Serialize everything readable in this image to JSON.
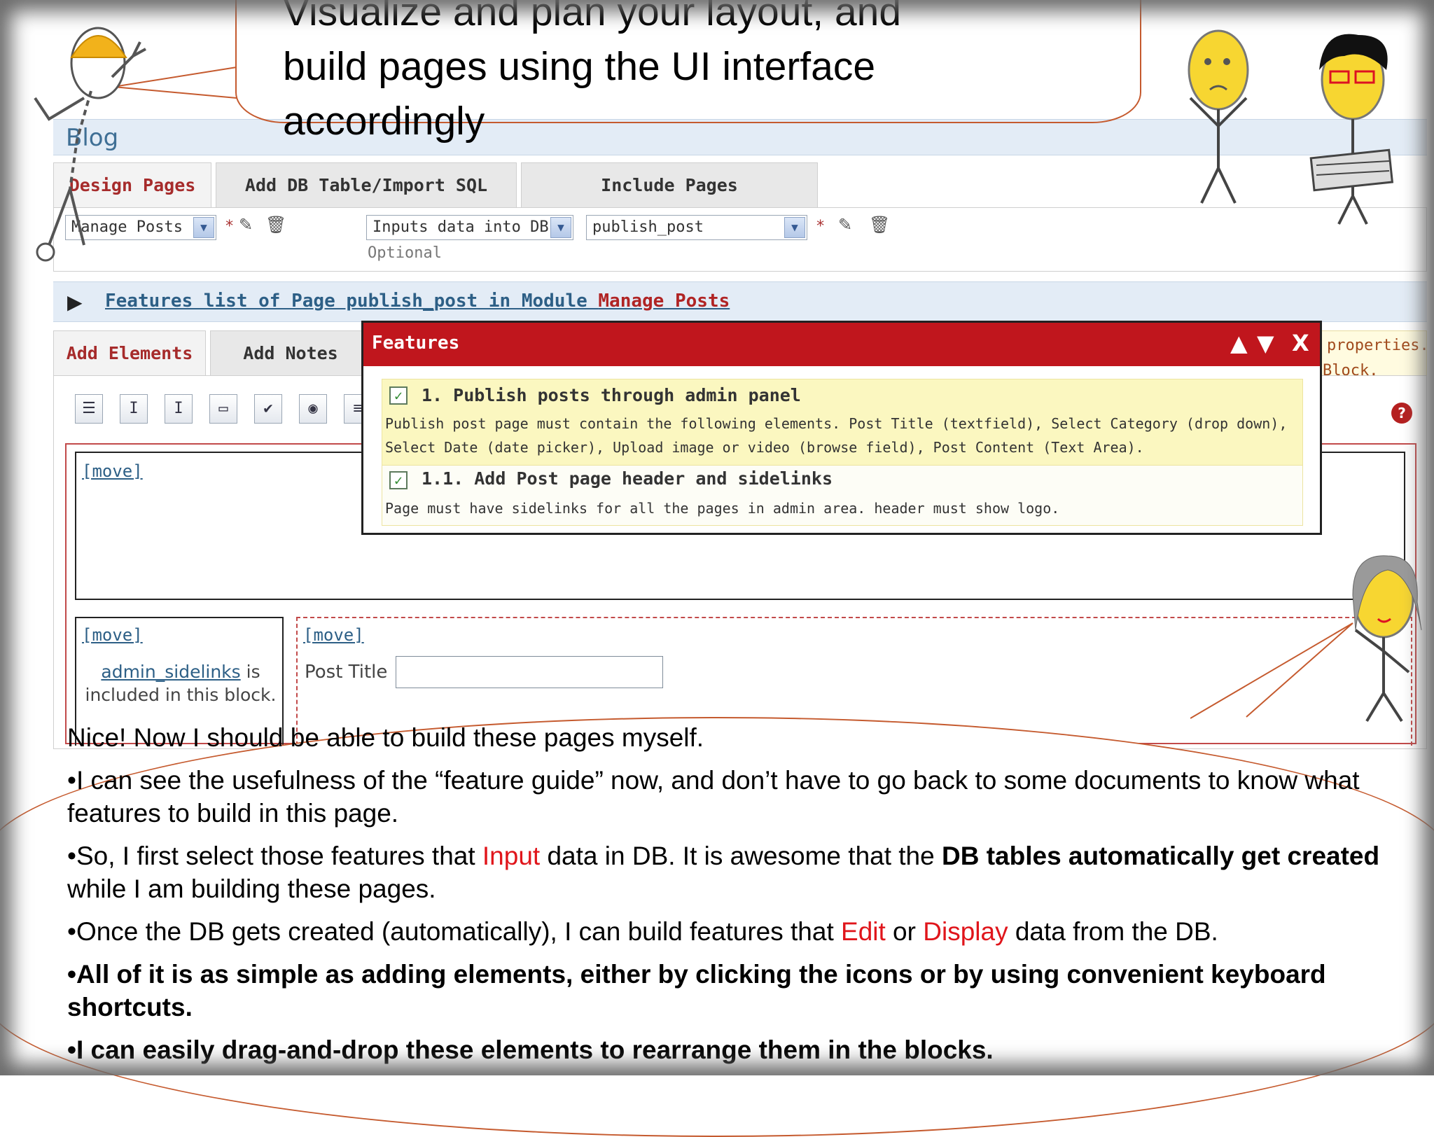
{
  "callout_top": {
    "lines": [
      "Visualize and plan your layout, and",
      "build pages using the UI interface",
      "accordingly"
    ]
  },
  "app": {
    "title": "Blog",
    "tabs": [
      "Design Pages",
      "Add DB Table/Import SQL",
      "Include Pages"
    ],
    "module_select": "Manage Posts",
    "purpose_select": "Inputs data into DB",
    "page_select": "publish_post",
    "optional_label": "Optional",
    "star": "*",
    "features_link": {
      "prefix": "Features list of Page publish_post in Module ",
      "module": "Manage Posts"
    },
    "tabs2": [
      "Add Elements",
      "Add Notes"
    ],
    "warn_lines": [
      "properties.",
      "Block."
    ],
    "move_label": "[move]",
    "sidelinks": {
      "link": "admin_sidelinks",
      "text_after": " is",
      "line2": "included in this block."
    },
    "post_title_label": "Post Title",
    "help": "?"
  },
  "features_popup": {
    "title": "Features",
    "controls": [
      "▲",
      "▼",
      "X"
    ],
    "items": [
      {
        "title": "1. Publish posts through admin panel",
        "desc": [
          "Publish post page must contain the following elements. Post Title (textfield), Select Category (drop down),",
          "Select Date (date picker), Upload image or video (browse field), Post Content (Text Area)."
        ]
      },
      {
        "title": "1.1. Add Post page header and sidelinks",
        "desc": [
          "Page must have sidelinks for all the pages in admin area. header must show logo."
        ]
      }
    ]
  },
  "bottom_callout": {
    "p1": "Nice!  Now I should be able to build these pages myself.",
    "p2": "•I can see the usefulness of the “feature guide” now, and don’t have to go back to some documents to know what features to build in this page.",
    "p3": {
      "a": "•So, I first select those features that ",
      "b": "Input",
      "c": " data in DB.  It is awesome that the ",
      "d": "DB tables automatically get created",
      "e": " while I am building these pages."
    },
    "p4": {
      "a": "•Once the DB gets created (automatically), I can build features that ",
      "b": "Edit",
      "c": " or ",
      "d": "Display",
      "e": " data from the DB."
    },
    "p5": "•All of it is as simple as adding elements, either by clicking the icons or by using convenient keyboard shortcuts.",
    "p6": "•I can easily drag-and-drop these elements to rearrange them in the blocks."
  },
  "colors": {
    "popup_header": "#c0161d",
    "accent_red": "#e0151b",
    "link_blue": "#2d5f86",
    "callout_border": "#c55a2e"
  },
  "icons": [
    "toolbar-form-icon",
    "textfield-icon",
    "textarea-icon",
    "dropdown-icon",
    "checkbox-icon",
    "radio-icon",
    "more-icon",
    "edit-icon",
    "delete-icon",
    "help-icon"
  ]
}
